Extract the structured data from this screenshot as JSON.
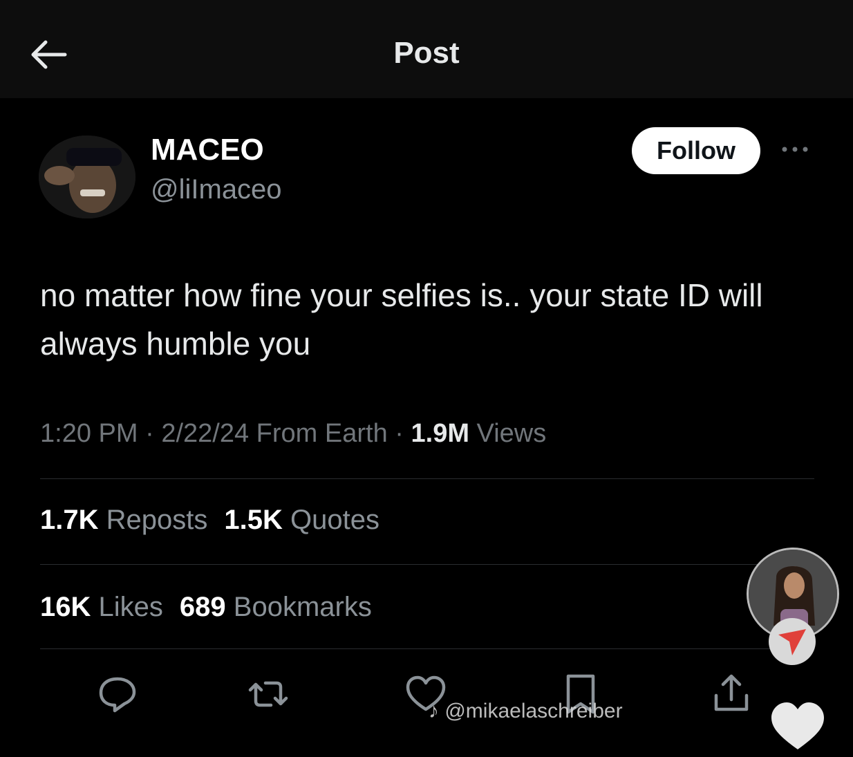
{
  "header": {
    "title": "Post",
    "back_icon": "arrow-left-icon"
  },
  "author": {
    "display_name": "MACEO",
    "handle": "@liImaceo",
    "follow_label": "Follow",
    "more_icon": "more-horizontal-icon"
  },
  "post": {
    "text": "no matter how fine your selfies is.. your state ID will always humble you",
    "time": "1:20 PM",
    "date": "2/22/24",
    "location": "From Earth",
    "views_count": "1.9M",
    "views_label": "Views"
  },
  "stats": {
    "reposts_count": "1.7K",
    "reposts_label": "Reposts",
    "quotes_count": "1.5K",
    "quotes_label": "Quotes",
    "likes_count": "16K",
    "likes_label": "Likes",
    "bookmarks_count": "689",
    "bookmarks_label": "Bookmarks"
  },
  "actions": [
    "reply-icon",
    "repost-icon",
    "like-icon",
    "bookmark-icon",
    "share-icon"
  ],
  "overlay": {
    "watermark": "@mikaelaschreiber",
    "send_icon": "send-icon",
    "heart_icon": "heart-icon"
  },
  "colors": {
    "background": "#000000",
    "header_bg": "#0d0d0d",
    "text_primary": "#e7e9ea",
    "text_secondary": "#71767b",
    "follow_bg": "#ffffff",
    "send_accent": "#e0403a"
  }
}
